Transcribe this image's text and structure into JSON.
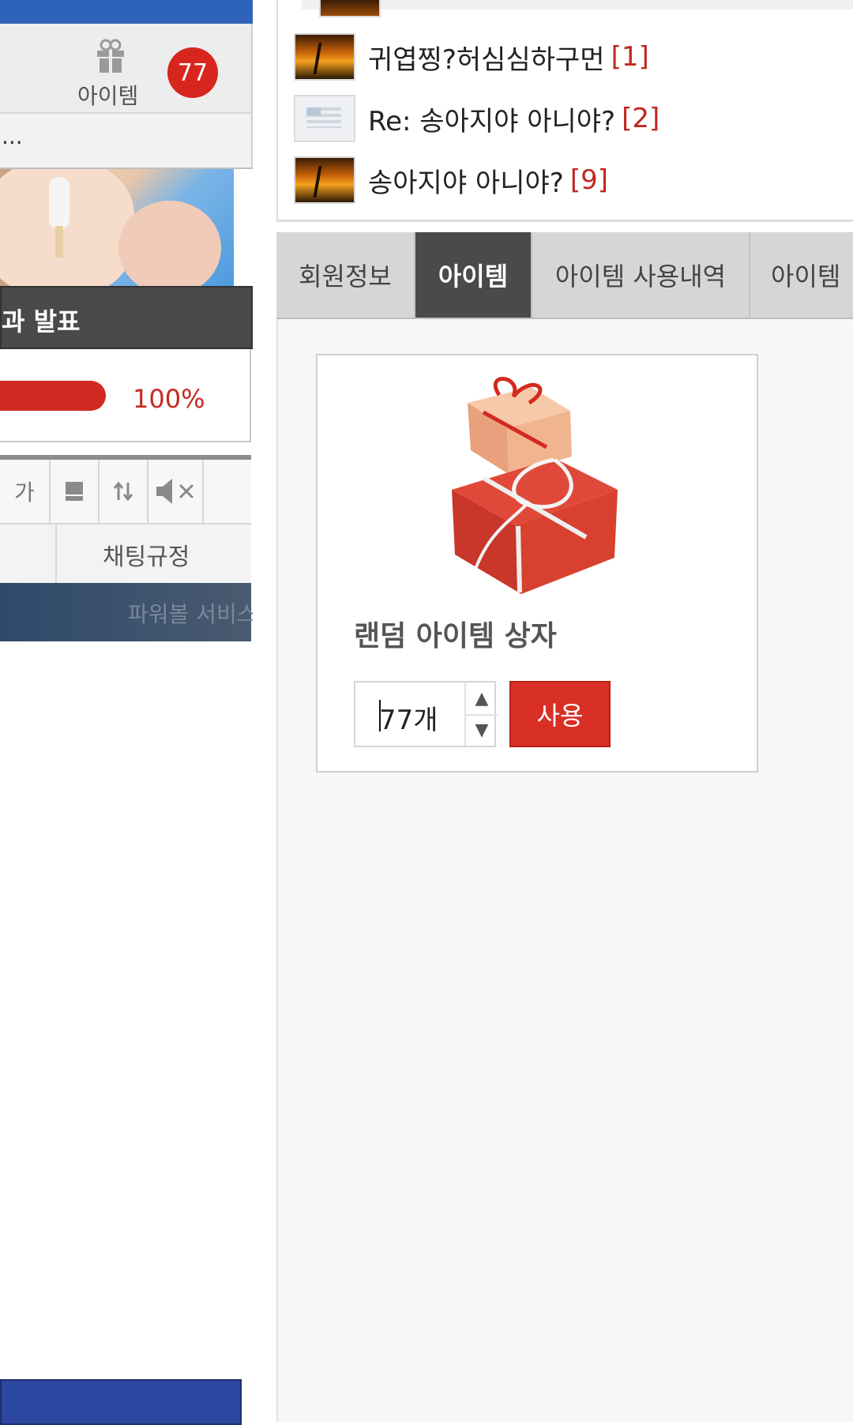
{
  "left": {
    "item_label": "아이템",
    "item_count_badge": "77",
    "ellipsis": "...",
    "dark_bar_text": "과 발표",
    "progress": {
      "value": 1.0,
      "text": "100%"
    },
    "toolbar": {
      "font_label": "가",
      "icons": [
        "font-size-icon",
        "note-icon",
        "sort-icon",
        "mute-icon"
      ]
    },
    "chat_rules": "채팅규정",
    "power_bar_text": "파워볼 서비스"
  },
  "posts": [
    {
      "title": "귀엽찡?허심심하구먼",
      "count": "[1]",
      "thumb": "sunset"
    },
    {
      "title": "Re: 송아지야 아니야?",
      "count": "[2]",
      "thumb": "doc"
    },
    {
      "title": "송아지야 아니야?",
      "count": "[9]",
      "thumb": "sunset"
    }
  ],
  "tabs": [
    {
      "label": "회원정보",
      "active": false
    },
    {
      "label": "아이템",
      "active": true
    },
    {
      "label": "아이템 사용내역",
      "active": false
    },
    {
      "label": "아이템",
      "active": false
    }
  ],
  "item_card": {
    "name": "랜덤 아이템 상자",
    "quantity_value": "77개",
    "use_button": "사용"
  },
  "colors": {
    "accent_red": "#d93026",
    "active_tab": "#4a4a4a",
    "top_blue": "#2f63b9"
  }
}
